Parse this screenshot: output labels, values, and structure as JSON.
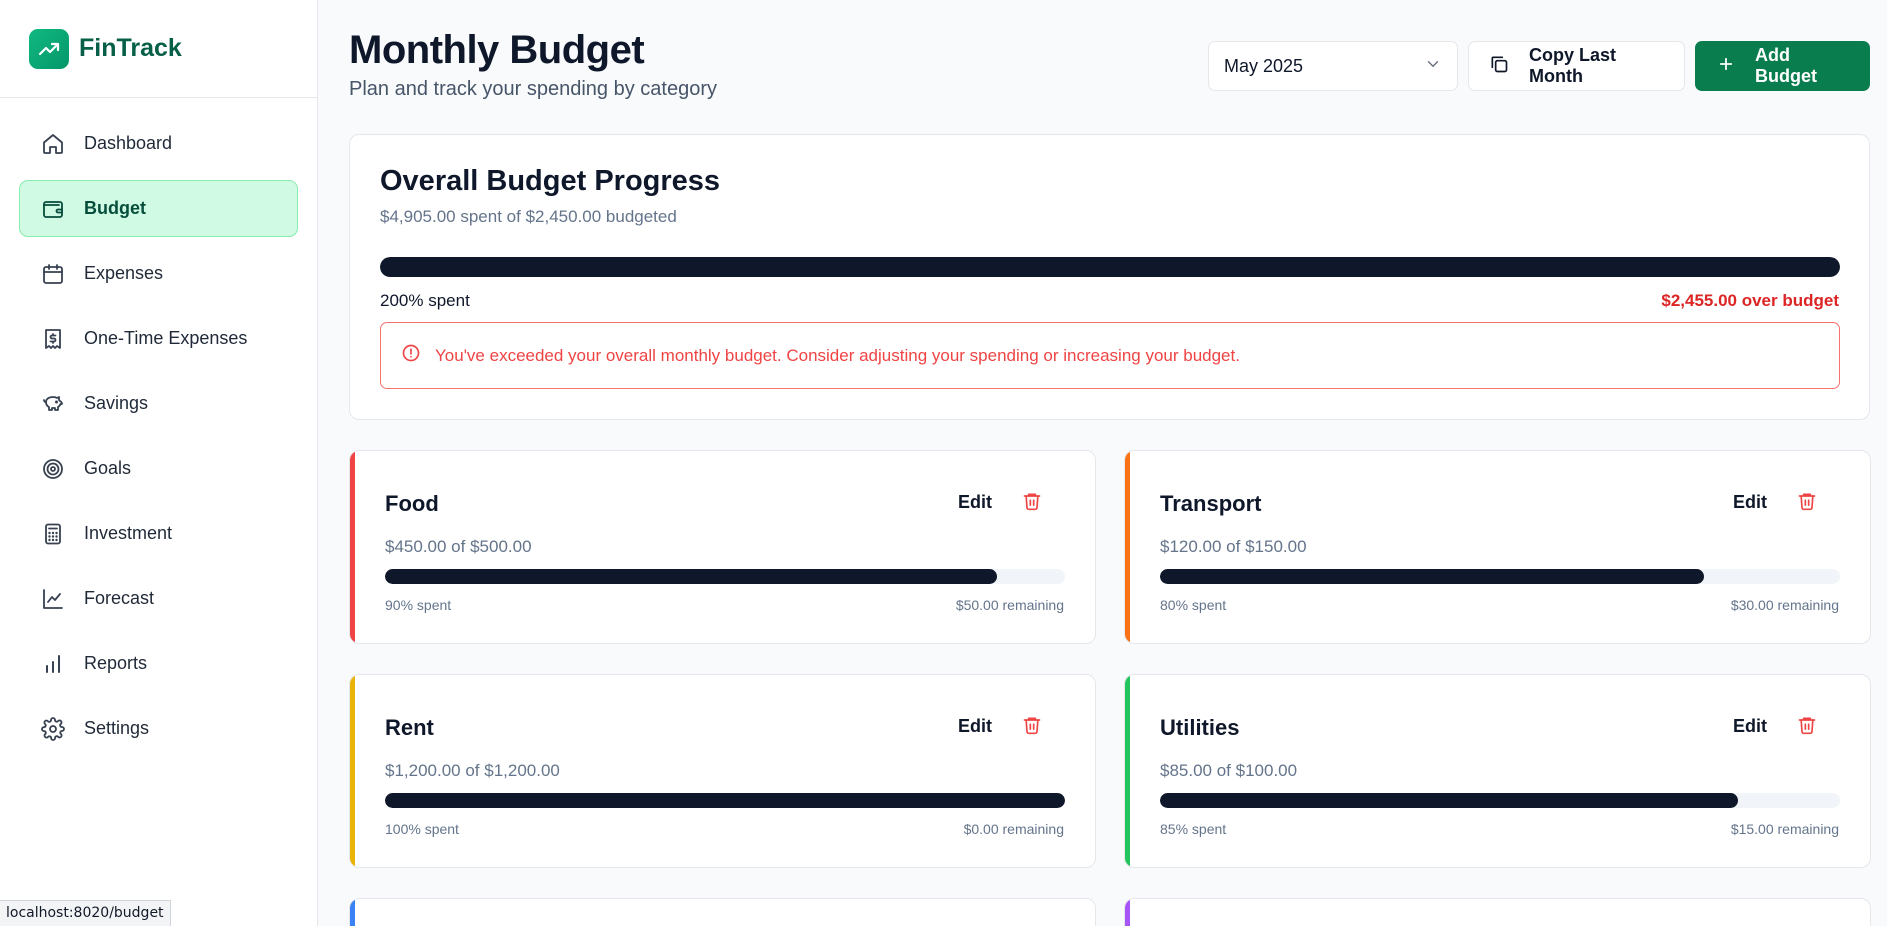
{
  "app": {
    "name": "FinTrack"
  },
  "sidebar": {
    "items": [
      {
        "label": "Dashboard",
        "icon": "home-icon"
      },
      {
        "label": "Budget",
        "icon": "wallet-icon",
        "active": true
      },
      {
        "label": "Expenses",
        "icon": "calendar-icon"
      },
      {
        "label": "One-Time Expenses",
        "icon": "receipt-dollar-icon"
      },
      {
        "label": "Savings",
        "icon": "piggy-bank-icon"
      },
      {
        "label": "Goals",
        "icon": "target-icon"
      },
      {
        "label": "Investment",
        "icon": "calculator-icon"
      },
      {
        "label": "Forecast",
        "icon": "line-chart-icon"
      },
      {
        "label": "Reports",
        "icon": "bar-chart-icon"
      },
      {
        "label": "Settings",
        "icon": "gear-icon"
      }
    ]
  },
  "header": {
    "title": "Monthly Budget",
    "subtitle": "Plan and track your spending by category",
    "month_select": "May 2025",
    "copy_label": "Copy Last Month",
    "add_label": "Add Budget"
  },
  "overall": {
    "title": "Overall Budget Progress",
    "summary": "$4,905.00 spent of $2,450.00 budgeted",
    "progress": 1.0,
    "percent_label": "200% spent",
    "over_label": "$2,455.00 over budget",
    "alert": "You've exceeded your overall monthly budget. Consider adjusting your spending or increasing your budget."
  },
  "categories": [
    {
      "name": "Food",
      "amount": "$450.00 of $500.00",
      "progress": 0.9,
      "percent": "90% spent",
      "remaining": "$50.00 remaining",
      "color": "#ef4444",
      "edit": "Edit"
    },
    {
      "name": "Transport",
      "amount": "$120.00 of $150.00",
      "progress": 0.8,
      "percent": "80% spent",
      "remaining": "$30.00 remaining",
      "color": "#f97316",
      "edit": "Edit"
    },
    {
      "name": "Rent",
      "amount": "$1,200.00 of $1,200.00",
      "progress": 1.0,
      "percent": "100% spent",
      "remaining": "$0.00 remaining",
      "color": "#eab308",
      "edit": "Edit"
    },
    {
      "name": "Utilities",
      "amount": "$85.00 of $100.00",
      "progress": 0.85,
      "percent": "85% spent",
      "remaining": "$15.00 remaining",
      "color": "#22c55e",
      "edit": "Edit"
    }
  ],
  "partial_cards": [
    {
      "color": "#3b82f6"
    },
    {
      "color": "#a855f7"
    }
  ],
  "status_bar": {
    "url": "localhost:8020/budget"
  }
}
